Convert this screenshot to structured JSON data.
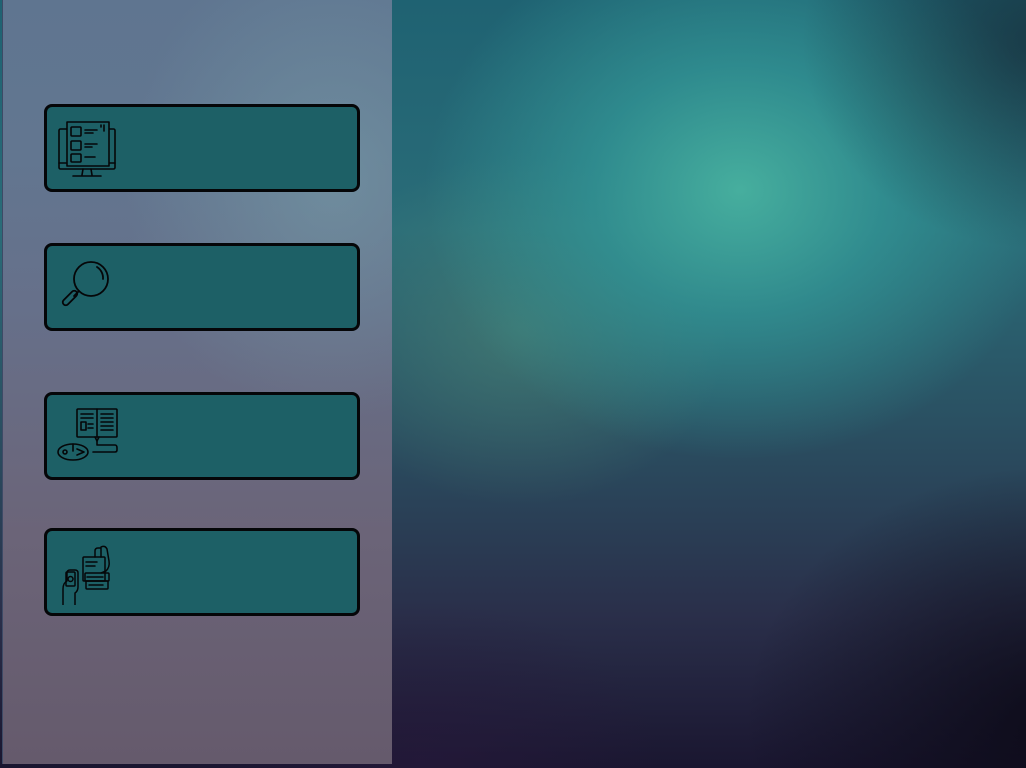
{
  "menu": {
    "items": [
      {
        "label": "",
        "icon": "computer-forms-icon"
      },
      {
        "label": "",
        "icon": "magnifier-icon"
      },
      {
        "label": "",
        "icon": "book-mouse-icon"
      },
      {
        "label": "",
        "icon": "hand-documents-icon"
      }
    ]
  },
  "colors": {
    "card_fill": "#1d6066",
    "card_border": "#050608",
    "panel": "#647590"
  }
}
